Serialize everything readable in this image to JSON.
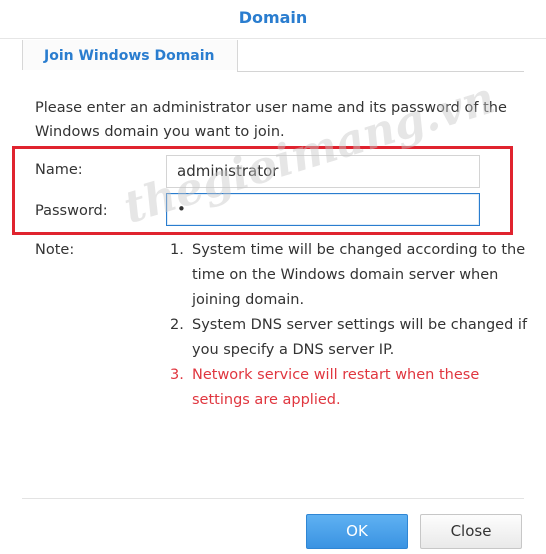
{
  "dialog": {
    "title": "Domain",
    "tab_label": "Join Windows Domain",
    "intro": "Please enter an administrator user name and its password of the Windows domain you want to join.",
    "name_label": "Name:",
    "name_value": "administrator",
    "password_label": "Password:",
    "password_value": "•",
    "note_label": "Note:",
    "notes": [
      {
        "num": "1.",
        "text": "System time will be changed according to the time on the Windows domain server when joining domain."
      },
      {
        "num": "2.",
        "text": "System DNS server settings will be changed if you specify a DNS server IP."
      },
      {
        "num": "3.",
        "text": "Network service will restart when these settings are applied."
      }
    ],
    "ok_label": "OK",
    "close_label": "Close",
    "watermark": "thegioimang.vn"
  },
  "colors": {
    "accent": "#2a7dcf",
    "highlight_box": "#e0232f",
    "warning_text": "#e0363f"
  }
}
